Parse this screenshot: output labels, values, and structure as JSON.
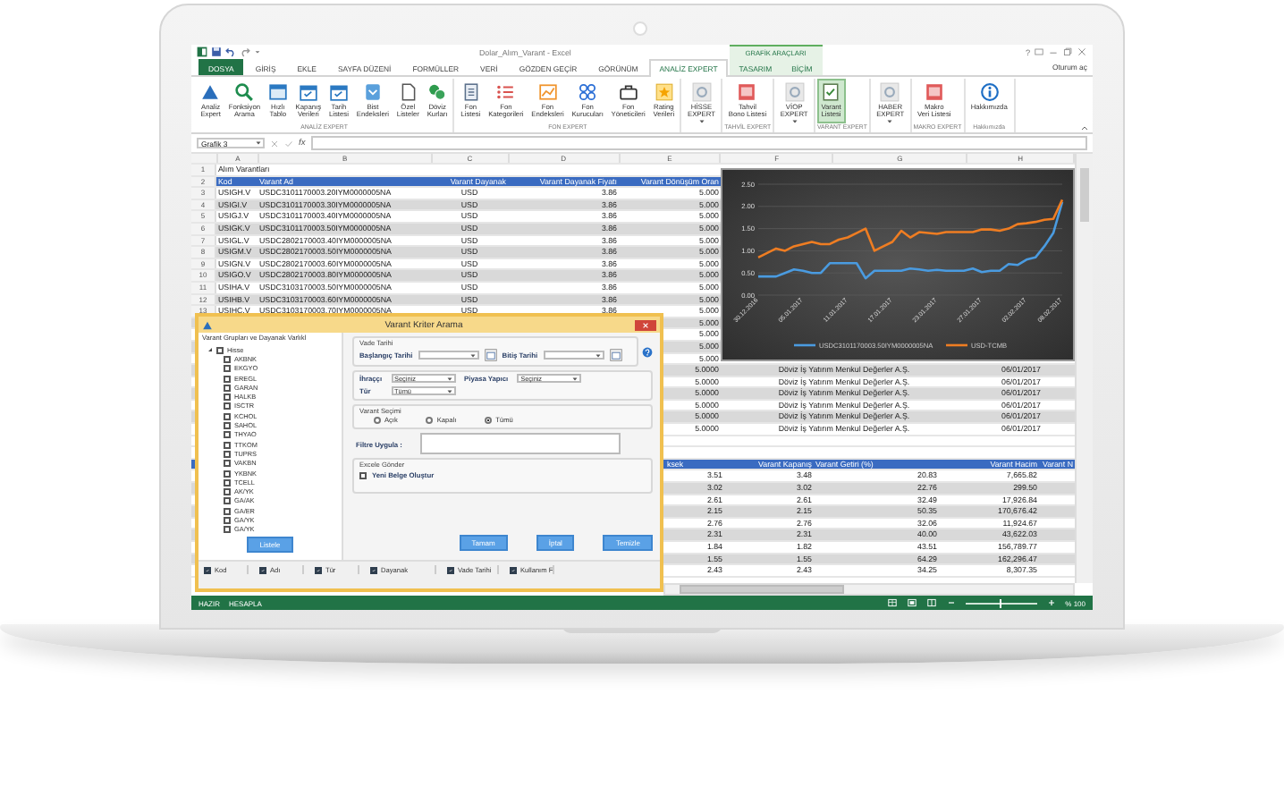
{
  "window": {
    "title": "Dolar_Alım_Varant - Excel",
    "context_group": "GRAFİK ARAÇLARI",
    "help": "?",
    "account": "Oturum aç"
  },
  "tabs": [
    {
      "label": "DOSYA",
      "kind": "file",
      "selected": false
    },
    {
      "label": "GİRİŞ",
      "kind": "tab",
      "selected": false
    },
    {
      "label": "EKLE",
      "kind": "tab",
      "selected": false
    },
    {
      "label": "SAYFA DÜZENİ",
      "kind": "tab",
      "selected": false
    },
    {
      "label": "FORMÜLLER",
      "kind": "tab",
      "selected": false
    },
    {
      "label": "VERİ",
      "kind": "tab",
      "selected": false
    },
    {
      "label": "GÖZDEN GEÇİR",
      "kind": "tab",
      "selected": false
    },
    {
      "label": "GÖRÜNÜM",
      "kind": "tab",
      "selected": false
    },
    {
      "label": "ANALİZ EXPERT",
      "kind": "tab",
      "selected": true
    },
    {
      "label": "TASARIM",
      "kind": "context",
      "selected": false
    },
    {
      "label": "BİÇİM",
      "kind": "context",
      "selected": false
    }
  ],
  "ribbon": {
    "groups": [
      {
        "label": "ANALİZ EXPERT",
        "buttons": [
          {
            "lines": [
              "Analiz",
              "Expert"
            ],
            "kind": "logo",
            "selected": false
          },
          {
            "lines": [
              "Fonksiyon",
              "Arama"
            ],
            "kind": "search",
            "selected": false
          },
          {
            "lines": [
              "Hızlı",
              "Tablo"
            ],
            "kind": "table",
            "selected": false
          },
          {
            "lines": [
              "Kapanış",
              "Verileri"
            ],
            "kind": "calendar",
            "selected": false
          },
          {
            "lines": [
              "Tarih",
              "Listesi"
            ],
            "kind": "calendar",
            "selected": false
          },
          {
            "lines": [
              "Bist",
              "Endeksleri"
            ],
            "kind": "badge",
            "selected": false
          },
          {
            "lines": [
              "Özel",
              "Listeler"
            ],
            "kind": "doc",
            "selected": false
          },
          {
            "lines": [
              "Döviz",
              "Kurları"
            ],
            "kind": "currency",
            "selected": false
          }
        ]
      },
      {
        "label": "FON EXPERT",
        "buttons": [
          {
            "lines": [
              "Fon",
              "Listesi"
            ],
            "kind": "page",
            "selected": false
          },
          {
            "lines": [
              "Fon",
              "Kategorileri"
            ],
            "kind": "list",
            "selected": false
          },
          {
            "lines": [
              "Fon",
              "Endeksleri"
            ],
            "kind": "chart",
            "selected": false
          },
          {
            "lines": [
              "Fon",
              "Kurucuları"
            ],
            "kind": "grid",
            "selected": false
          },
          {
            "lines": [
              "Fon",
              "Yöneticileri"
            ],
            "kind": "briefcase",
            "selected": false
          },
          {
            "lines": [
              "Rating",
              "Verileri"
            ],
            "kind": "star",
            "selected": false
          }
        ]
      },
      {
        "buttons": [
          {
            "lines": [
              "HİSSE",
              "EXPERT"
            ],
            "kind": "menu",
            "selected": false
          }
        ]
      },
      {
        "label": "TAHVİL EXPERT",
        "buttons": [
          {
            "lines": [
              "Tahvil",
              "Bono Listesi"
            ],
            "kind": "report",
            "selected": false
          }
        ]
      },
      {
        "buttons": [
          {
            "lines": [
              "VİOP",
              "EXPERT"
            ],
            "kind": "menu",
            "selected": false
          }
        ]
      },
      {
        "label": "VARANT EXPERT",
        "buttons": [
          {
            "lines": [
              "Varant",
              "Listesi"
            ],
            "kind": "varant",
            "selected": true
          }
        ]
      },
      {
        "buttons": [
          {
            "lines": [
              "HABER",
              "EXPERT"
            ],
            "kind": "menu",
            "selected": false
          }
        ]
      },
      {
        "label": "MAKRO EXPERT",
        "buttons": [
          {
            "lines": [
              "Makro",
              "Veri Listesi"
            ],
            "kind": "report",
            "selected": false
          }
        ]
      },
      {
        "label": "Hakkımızda",
        "buttons": [
          {
            "lines": [
              "Hakkımızda"
            ],
            "kind": "info",
            "selected": false
          }
        ]
      }
    ]
  },
  "formula_bar": {
    "name_box": "Grafik 3",
    "fx": "fx"
  },
  "sheet": {
    "columns": [
      "A",
      "B",
      "C",
      "D",
      "E",
      "F",
      "G",
      "H"
    ],
    "title_row": {
      "number": "1",
      "text": "Alım Varantları"
    },
    "header": {
      "number": "2",
      "cells": [
        "Kod",
        "Varant Ad",
        "Varant Dayanak",
        "Varant Dayanak Fiyatı",
        "Varant Dönüşüm Oran"
      ]
    },
    "rows": [
      {
        "number": "3",
        "cells": [
          "USIGH.V",
          "USDC3101170003.20IYM0000005NA",
          "USD",
          "3.86",
          "5.000"
        ]
      },
      {
        "number": "4",
        "cells": [
          "USIGI.V",
          "USDC3101170003.30IYM0000005NA",
          "USD",
          "3.86",
          "5.000"
        ]
      },
      {
        "number": "5",
        "cells": [
          "USIGJ.V",
          "USDC3101170003.40IYM0000005NA",
          "USD",
          "3.86",
          "5.000"
        ]
      },
      {
        "number": "6",
        "cells": [
          "USIGK.V",
          "USDC3101170003.50IYM0000005NA",
          "USD",
          "3.86",
          "5.000"
        ]
      },
      {
        "number": "7",
        "cells": [
          "USIGL.V",
          "USDC2802170003.40IYM0000005NA",
          "USD",
          "3.86",
          "5.000"
        ]
      },
      {
        "number": "8",
        "cells": [
          "USIGM.V",
          "USDC2802170003.50IYM0000005NA",
          "USD",
          "3.86",
          "5.000"
        ]
      },
      {
        "number": "9",
        "cells": [
          "USIGN.V",
          "USDC2802170003.60IYM0000005NA",
          "USD",
          "3.86",
          "5.000"
        ]
      },
      {
        "number": "10",
        "cells": [
          "USIGO.V",
          "USDC2802170003.80IYM0000005NA",
          "USD",
          "3.86",
          "5.000"
        ]
      },
      {
        "number": "11",
        "cells": [
          "USIHA.V",
          "USDC3103170003.50IYM0000005NA",
          "USD",
          "3.86",
          "5.000"
        ]
      },
      {
        "number": "12",
        "cells": [
          "USIHB.V",
          "USDC3103170003.60IYM0000005NA",
          "USD",
          "3.86",
          "5.000"
        ]
      },
      {
        "number": "13",
        "cells": [
          "USIHC.V",
          "USDC3103170003.70IYM0000005NA",
          "USD",
          "3.86",
          "5.000"
        ]
      }
    ],
    "ratio_rows": [
      "5.000",
      "5.000",
      "5.000",
      "5.000"
    ],
    "issuer_rows": [
      {
        "ratio": "5.0000",
        "issuer": "Döviz İş Yatırım Menkul Değerler A.Ş.",
        "date": "06/01/2017"
      },
      {
        "ratio": "5.0000",
        "issuer": "Döviz İş Yatırım Menkul Değerler A.Ş.",
        "date": "06/01/2017"
      },
      {
        "ratio": "5.0000",
        "issuer": "Döviz İş Yatırım Menkul Değerler A.Ş.",
        "date": "06/01/2017"
      },
      {
        "ratio": "5.0000",
        "issuer": "Döviz İş Yatırım Menkul Değerler A.Ş.",
        "date": "06/01/2017"
      },
      {
        "ratio": "5.0000",
        "issuer": "Döviz İş Yatırım Menkul Değerler A.Ş.",
        "date": "06/01/2017"
      },
      {
        "ratio": "5.0000",
        "issuer": "Döviz İş Yatırım Menkul Değerler A.Ş.",
        "date": "06/01/2017"
      }
    ],
    "lower_table": {
      "columns": [
        "ksek",
        "Varant Kapanış",
        "Varant Getiri (%)",
        "Varant Hacim",
        "Varant N"
      ],
      "rows": [
        [
          "3.51",
          "3.48",
          "20.83",
          "7,665.82"
        ],
        [
          "3.02",
          "3.02",
          "22.76",
          "299.50"
        ],
        [
          "2.61",
          "2.61",
          "32.49",
          "17,926.84"
        ],
        [
          "2.15",
          "2.15",
          "50.35",
          "170,676.42"
        ],
        [
          "2.76",
          "2.76",
          "32.06",
          "11,924.67"
        ],
        [
          "2.31",
          "2.31",
          "40.00",
          "43,622.03"
        ],
        [
          "1.84",
          "1.82",
          "43.51",
          "156,789.77"
        ],
        [
          "1.55",
          "1.55",
          "64.29",
          "162,296.47"
        ],
        [
          "2.43",
          "2.43",
          "34.25",
          "8,307.35"
        ]
      ]
    },
    "chart": {
      "chart_data": {
        "type": "line",
        "categories": [
          "30.12.2016",
          null,
          null,
          null,
          null,
          "05.01.2017",
          null,
          null,
          null,
          null,
          "11.01.2017",
          null,
          null,
          null,
          null,
          "17.01.2017",
          null,
          null,
          null,
          null,
          "23.01.2017",
          null,
          null,
          null,
          null,
          "27.01.2017",
          null,
          null,
          null,
          null,
          "02.02.2017",
          null,
          null,
          null,
          "08.02.2017"
        ],
        "ylim": [
          0,
          2.5
        ],
        "grid": true,
        "legend": "bottom",
        "yticks": [
          {
            "value": 0,
            "label": "0.00"
          },
          {
            "value": 0.5,
            "label": "0.50"
          },
          {
            "value": 1,
            "label": "1.00"
          },
          {
            "value": 1.5,
            "label": "1.50"
          },
          {
            "value": 2,
            "label": "2.00"
          },
          {
            "value": 2.5,
            "label": "2.50"
          }
        ],
        "series": [
          {
            "name": "USDC3101170003.50IYM0000005NA",
            "color": "#4a9be0",
            "values": [
              0.42,
              0.42,
              0.42,
              0.5,
              0.58,
              0.55,
              0.5,
              0.5,
              0.72,
              0.72,
              0.72,
              0.72,
              0.38,
              0.55,
              0.55,
              0.55,
              0.55,
              0.6,
              0.58,
              0.55,
              0.57,
              0.55,
              0.55,
              0.55,
              0.6,
              0.52,
              0.55,
              0.55,
              0.7,
              0.68,
              0.8,
              0.85,
              1.1,
              1.4,
              2.1
            ]
          },
          {
            "name": "USD-TCMB",
            "color": "#ef7d22",
            "values": [
              0.85,
              0.95,
              1.05,
              1.0,
              1.1,
              1.15,
              1.2,
              1.15,
              1.15,
              1.25,
              1.3,
              1.4,
              1.5,
              1.0,
              1.1,
              1.2,
              1.45,
              1.3,
              1.42,
              1.4,
              1.38,
              1.42,
              1.42,
              1.42,
              1.42,
              1.48,
              1.48,
              1.45,
              1.5,
              1.6,
              1.62,
              1.65,
              1.7,
              1.72,
              2.15
            ]
          }
        ]
      }
    }
  },
  "dialog": {
    "title": "Varant Kriter Arama",
    "groups_panel": {
      "title": "Varant Grupları ve Dayanak Varlıkl",
      "tree": [
        {
          "label": "Hisse",
          "checked": false,
          "expanded": true,
          "children": [
            {
              "label": "AKBNK",
              "checked": false
            },
            {
              "label": "EKGYO",
              "checked": false
            },
            {
              "label": "EREGL",
              "checked": false
            },
            {
              "label": "GARAN",
              "checked": false
            },
            {
              "label": "HALKB",
              "checked": false
            },
            {
              "label": "ISCTR",
              "checked": false
            },
            {
              "label": "KCHOL",
              "checked": false
            },
            {
              "label": "SAHOL",
              "checked": false
            },
            {
              "label": "THYAO",
              "checked": false
            },
            {
              "label": "TTKOM",
              "checked": false
            },
            {
              "label": "TUPRS",
              "checked": false
            },
            {
              "label": "VAKBN",
              "checked": false
            },
            {
              "label": "YKBNK",
              "checked": false
            },
            {
              "label": "TCELL",
              "checked": false
            },
            {
              "label": "AK/YK",
              "checked": false
            },
            {
              "label": "GA/AK",
              "checked": false
            },
            {
              "label": "GA/ER",
              "checked": false
            },
            {
              "label": "GA/YK",
              "checked": false
            },
            {
              "label": "GA/YK",
              "checked": false
            }
          ]
        }
      ],
      "button": "Listele"
    },
    "maturity": {
      "legend": "Vade Tarihi",
      "start_label": "Başlangıç Tarihi",
      "end_label": "Bitiş Tarihi"
    },
    "filters": [
      {
        "label": "İhraççı",
        "value": "Seçiniz"
      },
      {
        "label": "Piyasa Yapıcı",
        "value": "Seçiniz"
      },
      {
        "label": "Tür",
        "value": "Tümü"
      }
    ],
    "selection": {
      "legend": "Varant Seçimi",
      "options": [
        {
          "label": "Açık",
          "selected": false
        },
        {
          "label": "Kapalı",
          "selected": false
        },
        {
          "label": "Tümü",
          "selected": true
        }
      ]
    },
    "filter_label": "Filtre Uygula :",
    "export": {
      "legend": "Excele Gönder",
      "label": "Yeni Belge Oluştur",
      "checked": false
    },
    "buttons": [
      "Tamam",
      "İptal",
      "Temizle"
    ],
    "columns": [
      {
        "label": "Kod",
        "checked": true
      },
      {
        "label": "Adı",
        "checked": true
      },
      {
        "label": "Tür",
        "checked": true
      },
      {
        "label": "Dayanak",
        "checked": true
      },
      {
        "label": "Vade Tarihi",
        "checked": true
      },
      {
        "label": "Kullanım F",
        "checked": true
      }
    ]
  },
  "status_bar": {
    "items": [
      "HAZIR",
      "HESAPLA"
    ],
    "zoom": {
      "level": 0.5,
      "label": "% 100"
    }
  }
}
